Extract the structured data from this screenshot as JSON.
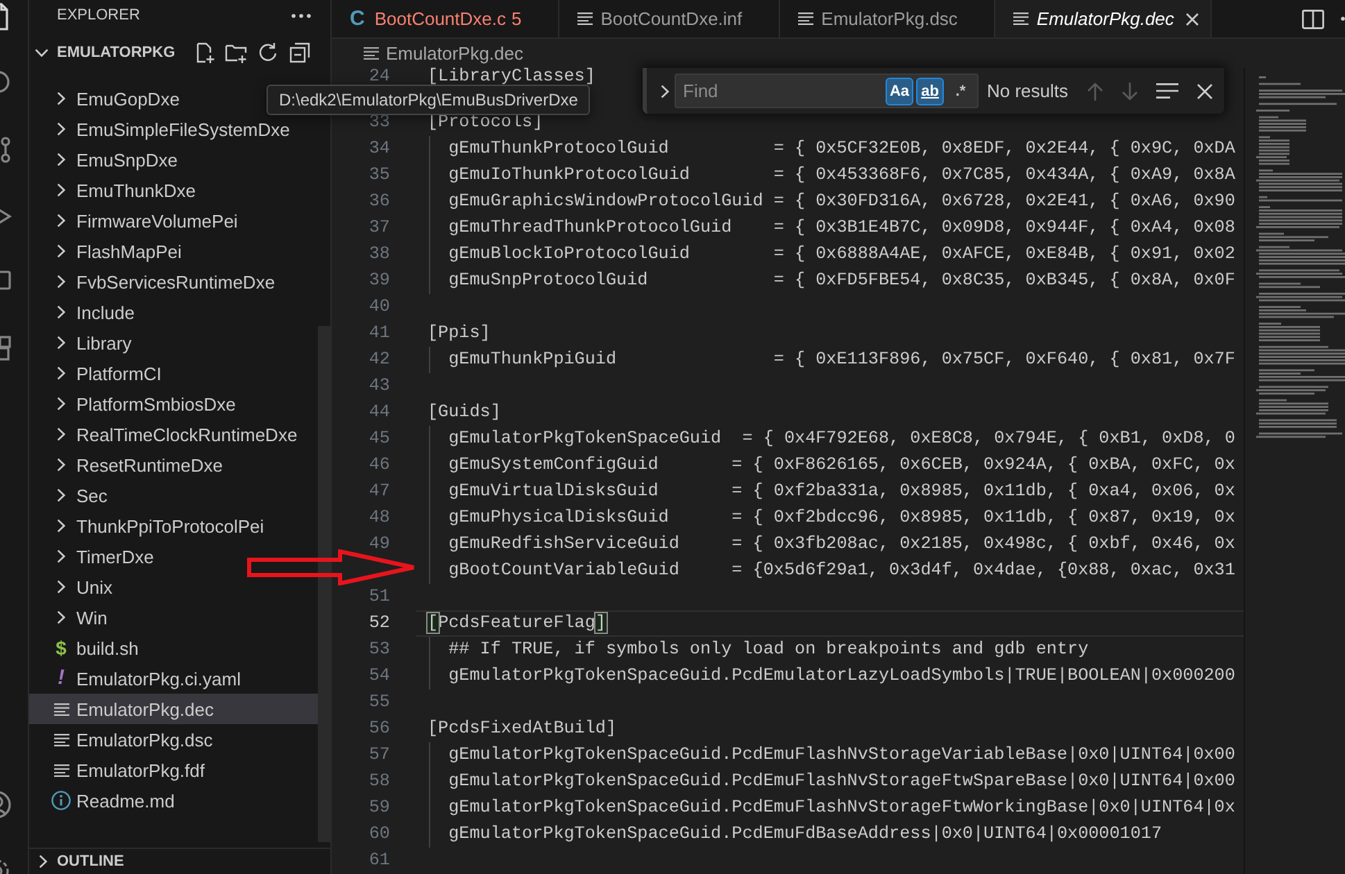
{
  "activity_bar": {
    "top": [
      {
        "kind": "files",
        "selected": true
      },
      {
        "kind": "search",
        "selected": false
      },
      {
        "kind": "source_control",
        "selected": false
      },
      {
        "kind": "run",
        "selected": false
      },
      {
        "kind": "remote",
        "selected": false
      },
      {
        "kind": "extensions",
        "selected": false
      }
    ],
    "bottom": [
      {
        "kind": "account"
      },
      {
        "kind": "manage"
      }
    ]
  },
  "sidebar": {
    "title": "EXPLORER",
    "actions": [
      {
        "kind": "more"
      }
    ],
    "section": {
      "title": "EMULATORPKG",
      "expanded": true,
      "actions": [
        {
          "kind": "new_file"
        },
        {
          "kind": "new_folder"
        },
        {
          "kind": "refresh"
        },
        {
          "kind": "collapse"
        }
      ]
    },
    "tree": [
      {
        "label": "EmuGopDxe",
        "kind": "folder",
        "expanded": false,
        "selected": false
      },
      {
        "label": "EmuSimpleFileSystemDxe",
        "kind": "folder",
        "expanded": false,
        "selected": false
      },
      {
        "label": "EmuSnpDxe",
        "kind": "folder",
        "expanded": false,
        "selected": false
      },
      {
        "label": "EmuThunkDxe",
        "kind": "folder",
        "expanded": false,
        "selected": false
      },
      {
        "label": "FirmwareVolumePei",
        "kind": "folder",
        "expanded": false,
        "selected": false
      },
      {
        "label": "FlashMapPei",
        "kind": "folder",
        "expanded": false,
        "selected": false
      },
      {
        "label": "FvbServicesRuntimeDxe",
        "kind": "folder",
        "expanded": false,
        "selected": false
      },
      {
        "label": "Include",
        "kind": "folder",
        "expanded": false,
        "selected": false
      },
      {
        "label": "Library",
        "kind": "folder",
        "expanded": false,
        "selected": false
      },
      {
        "label": "PlatformCI",
        "kind": "folder",
        "expanded": false,
        "selected": false
      },
      {
        "label": "PlatformSmbiosDxe",
        "kind": "folder",
        "expanded": false,
        "selected": false
      },
      {
        "label": "RealTimeClockRuntimeDxe",
        "kind": "folder",
        "expanded": false,
        "selected": false
      },
      {
        "label": "ResetRuntimeDxe",
        "kind": "folder",
        "expanded": false,
        "selected": false
      },
      {
        "label": "Sec",
        "kind": "folder",
        "expanded": false,
        "selected": false
      },
      {
        "label": "ThunkPpiToProtocolPei",
        "kind": "folder",
        "expanded": false,
        "selected": false
      },
      {
        "label": "TimerDxe",
        "kind": "folder",
        "expanded": false,
        "selected": false
      },
      {
        "label": "Unix",
        "kind": "folder",
        "expanded": false,
        "selected": false
      },
      {
        "label": "Win",
        "kind": "folder",
        "expanded": false,
        "selected": false
      },
      {
        "label": "build.sh",
        "kind": "shell",
        "glyph": "$",
        "selected": false
      },
      {
        "label": "EmulatorPkg.ci.yaml",
        "kind": "yaml",
        "glyph": "!",
        "selected": false
      },
      {
        "label": "EmulatorPkg.dec",
        "kind": "text",
        "selected": true
      },
      {
        "label": "EmulatorPkg.dsc",
        "kind": "text",
        "selected": false
      },
      {
        "label": "EmulatorPkg.fdf",
        "kind": "text",
        "selected": false
      },
      {
        "label": "Readme.md",
        "kind": "info",
        "selected": false
      }
    ],
    "outline": {
      "title": "OUTLINE",
      "expanded": false
    }
  },
  "tooltip": {
    "text": "D:\\edk2\\EmulatorPkg\\EmuBusDriverDxe"
  },
  "editor": {
    "tabs": [
      {
        "label": "BootCountDxe.c",
        "kind": "c",
        "glyph": "C",
        "problems": "5",
        "selected": false,
        "preview": false
      },
      {
        "label": "BootCountDxe.inf",
        "kind": "text",
        "selected": false,
        "preview": false
      },
      {
        "label": "EmulatorPkg.dsc",
        "kind": "text",
        "selected": false,
        "preview": false
      },
      {
        "label": "EmulatorPkg.dec",
        "kind": "text",
        "selected": true,
        "preview": true
      }
    ],
    "actions": [
      {
        "kind": "split"
      },
      {
        "kind": "more"
      }
    ],
    "breadcrumb": [
      {
        "label": "EmulatorPkg.dec",
        "kind": "text"
      }
    ],
    "sticky_line": {
      "number": "24",
      "text": "[LibraryClasses]"
    },
    "lines": [
      {
        "number": "33",
        "text": "[Protocols]",
        "guide": false,
        "current": false,
        "bracket_match": false
      },
      {
        "number": "34",
        "text": "  gEmuThunkProtocolGuid          = { 0x5CF32E0B, 0x8EDF, 0x2E44, { 0x9C, 0xDA",
        "guide": true,
        "current": false,
        "bracket_match": false
      },
      {
        "number": "35",
        "text": "  gEmuIoThunkProtocolGuid        = { 0x453368F6, 0x7C85, 0x434A, { 0xA9, 0x8A",
        "guide": true,
        "current": false,
        "bracket_match": false
      },
      {
        "number": "36",
        "text": "  gEmuGraphicsWindowProtocolGuid = { 0x30FD316A, 0x6728, 0x2E41, { 0xA6, 0x90",
        "guide": true,
        "current": false,
        "bracket_match": false
      },
      {
        "number": "37",
        "text": "  gEmuThreadThunkProtocolGuid    = { 0x3B1E4B7C, 0x09D8, 0x944F, { 0xA4, 0x08",
        "guide": true,
        "current": false,
        "bracket_match": false
      },
      {
        "number": "38",
        "text": "  gEmuBlockIoProtocolGuid        = { 0x6888A4AE, 0xAFCE, 0xE84B, { 0x91, 0x02",
        "guide": true,
        "current": false,
        "bracket_match": false
      },
      {
        "number": "39",
        "text": "  gEmuSnpProtocolGuid            = { 0xFD5FBE54, 0x8C35, 0xB345, { 0x8A, 0x0F",
        "guide": true,
        "current": false,
        "bracket_match": false
      },
      {
        "number": "40",
        "guide": false,
        "current": false
      },
      {
        "number": "41",
        "text": "[Ppis]",
        "guide": false,
        "current": false,
        "bracket_match": false
      },
      {
        "number": "42",
        "text": "  gEmuThunkPpiGuid               = { 0xE113F896, 0x75CF, 0xF640, { 0x81, 0x7F",
        "guide": true,
        "current": false,
        "bracket_match": false
      },
      {
        "number": "43",
        "guide": false,
        "current": false
      },
      {
        "number": "44",
        "text": "[Guids]",
        "guide": false,
        "current": false,
        "bracket_match": false
      },
      {
        "number": "45",
        "text": "  gEmulatorPkgTokenSpaceGuid  = { 0x4F792E68, 0xE8C8, 0x794E, { 0xB1, 0xD8, 0",
        "guide": true,
        "current": false,
        "bracket_match": false
      },
      {
        "number": "46",
        "text": "  gEmuSystemConfigGuid       = { 0xF8626165, 0x6CEB, 0x924A, { 0xBA, 0xFC, 0x",
        "guide": true,
        "current": false,
        "bracket_match": false
      },
      {
        "number": "47",
        "text": "  gEmuVirtualDisksGuid       = { 0xf2ba331a, 0x8985, 0x11db, { 0xa4, 0x06, 0x",
        "guide": true,
        "current": false,
        "bracket_match": false
      },
      {
        "number": "48",
        "text": "  gEmuPhysicalDisksGuid      = { 0xf2bdcc96, 0x8985, 0x11db, { 0x87, 0x19, 0x",
        "guide": true,
        "current": false,
        "bracket_match": false
      },
      {
        "number": "49",
        "text": "  gEmuRedfishServiceGuid     = { 0x3fb208ac, 0x2185, 0x498c, { 0xbf, 0x46, 0x",
        "guide": true,
        "current": false,
        "bracket_match": false
      },
      {
        "text": "  gBootCountVariableGuid     = {0x5d6f29a1, 0x3d4f, 0x4dae, {0x88, 0xac, 0x31",
        "guide": true,
        "current": false,
        "bracket_match": false
      },
      {
        "number": "51",
        "guide": false,
        "current": false
      },
      {
        "number": "52",
        "text": "[PcdsFeatureFlag]",
        "guide": false,
        "current": true,
        "bracket_match": true
      },
      {
        "number": "53",
        "text": "  ## If TRUE, if symbols only load on breakpoints and gdb entry",
        "guide": true,
        "current": false,
        "bracket_match": false
      },
      {
        "number": "54",
        "text": "  gEmulatorPkgTokenSpaceGuid.PcdEmulatorLazyLoadSymbols|TRUE|BOOLEAN|0x000200",
        "guide": true,
        "current": false,
        "bracket_match": false
      },
      {
        "number": "55",
        "guide": false,
        "current": false
      },
      {
        "number": "56",
        "text": "[PcdsFixedAtBuild]",
        "guide": false,
        "current": false,
        "bracket_match": false
      },
      {
        "number": "57",
        "text": "  gEmulatorPkgTokenSpaceGuid.PcdEmuFlashNvStorageVariableBase|0x0|UINT64|0x00",
        "guide": true,
        "current": false,
        "bracket_match": false
      },
      {
        "number": "58",
        "text": "  gEmulatorPkgTokenSpaceGuid.PcdEmuFlashNvStorageFtwSpareBase|0x0|UINT64|0x00",
        "guide": true,
        "current": false,
        "bracket_match": false
      },
      {
        "number": "59",
        "text": "  gEmulatorPkgTokenSpaceGuid.PcdEmuFlashNvStorageFtwWorkingBase|0x0|UINT64|0x",
        "guide": true,
        "current": false,
        "bracket_match": false
      },
      {
        "number": "60",
        "text": "  gEmulatorPkgTokenSpaceGuid.PcdEmuFdBaseAddress|0x0|UINT64|0x00001017",
        "guide": true,
        "current": false,
        "bracket_match": false
      },
      {
        "number": "61",
        "guide": false,
        "current": false
      }
    ],
    "find": {
      "expanded": false,
      "placeholder": "Find",
      "toggles": [
        {
          "kind": "case",
          "label": "Aa",
          "selected": true
        },
        {
          "kind": "word",
          "label": "ab",
          "selected": true
        },
        {
          "kind": "regex",
          "label": ".*",
          "selected": false
        }
      ],
      "result": "No results",
      "buttons": [
        {
          "kind": "previous",
          "disabled": true
        },
        {
          "kind": "next",
          "disabled": true
        },
        {
          "kind": "selection",
          "disabled": false
        },
        {
          "kind": "close",
          "disabled": false
        }
      ]
    }
  },
  "annotations": [
    {
      "kind": "arrow"
    }
  ]
}
